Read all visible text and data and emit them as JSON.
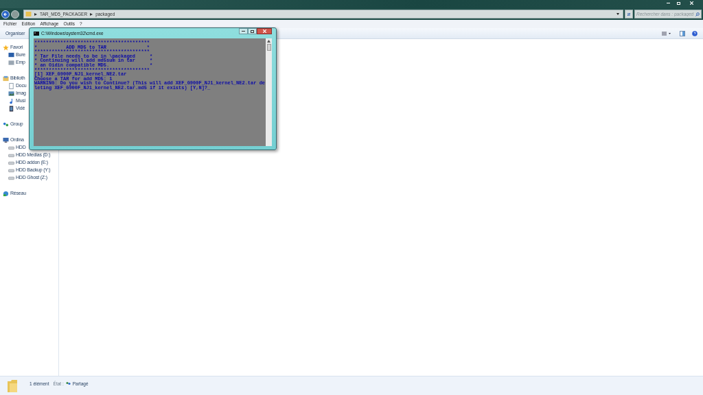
{
  "address_bar": {
    "crumbs": [
      "TAR_MD5_PACKAGER",
      "packaged"
    ]
  },
  "search": {
    "placeholder": "Rechercher dans : packaged"
  },
  "menu": [
    "Fichier",
    "Edition",
    "Affichage",
    "Outils",
    "?"
  ],
  "toolbar": {
    "organize": "Organiser"
  },
  "sidebar": {
    "groups": [
      {
        "label": "Favori",
        "kind": "favorites",
        "children": [
          {
            "label": "Bure",
            "kind": "desktop"
          },
          {
            "label": "Emp",
            "kind": "places"
          }
        ]
      },
      {
        "label": "Biblioth",
        "kind": "libraries",
        "children": [
          {
            "label": "Docu",
            "kind": "documents"
          },
          {
            "label": "Imag",
            "kind": "images"
          },
          {
            "label": "Musi",
            "kind": "music"
          },
          {
            "label": "Vidé",
            "kind": "videos"
          }
        ]
      },
      {
        "label": "Group",
        "kind": "homegroup"
      },
      {
        "label": "Ordina",
        "kind": "computer",
        "children": [
          {
            "label": "HDD",
            "kind": "drive"
          },
          {
            "label": "HDD Medias (D:)",
            "kind": "drive"
          },
          {
            "label": "HDD addon (E:)",
            "kind": "drive"
          },
          {
            "label": "HDD Backup (Y:)",
            "kind": "drive"
          },
          {
            "label": "HDD Ghost (Z:)",
            "kind": "drive"
          }
        ]
      },
      {
        "label": "Réseau",
        "kind": "network"
      }
    ]
  },
  "status_bar": {
    "count": "1 élément",
    "state_label": "État :",
    "state": "Partagé"
  },
  "console_window": {
    "title": "C:\\Windows\\system32\\cmd.exe",
    "lines": [
      "****************************************",
      "*          ADD MD5 to TAR              *",
      "****************************************",
      "* Tar File needs to be in \\packaged     *",
      "* Continuing will add md5sum in tar     *",
      "* an Oidin compatible MD5.              *",
      "****************************************",
      "[1] XEF_G900F_NJ1_kernel_NE2.tar",
      "Choose a TAR for add MD5: 1",
      "WARNING: Do you wish to Continue? (This will add XEF_G900F_NJ1_kernel_NE2.tar de",
      "leting XEF_G900F_NJ1_kernel_NE2.tar.md5 if it exists) [Y,N]?_"
    ]
  }
}
